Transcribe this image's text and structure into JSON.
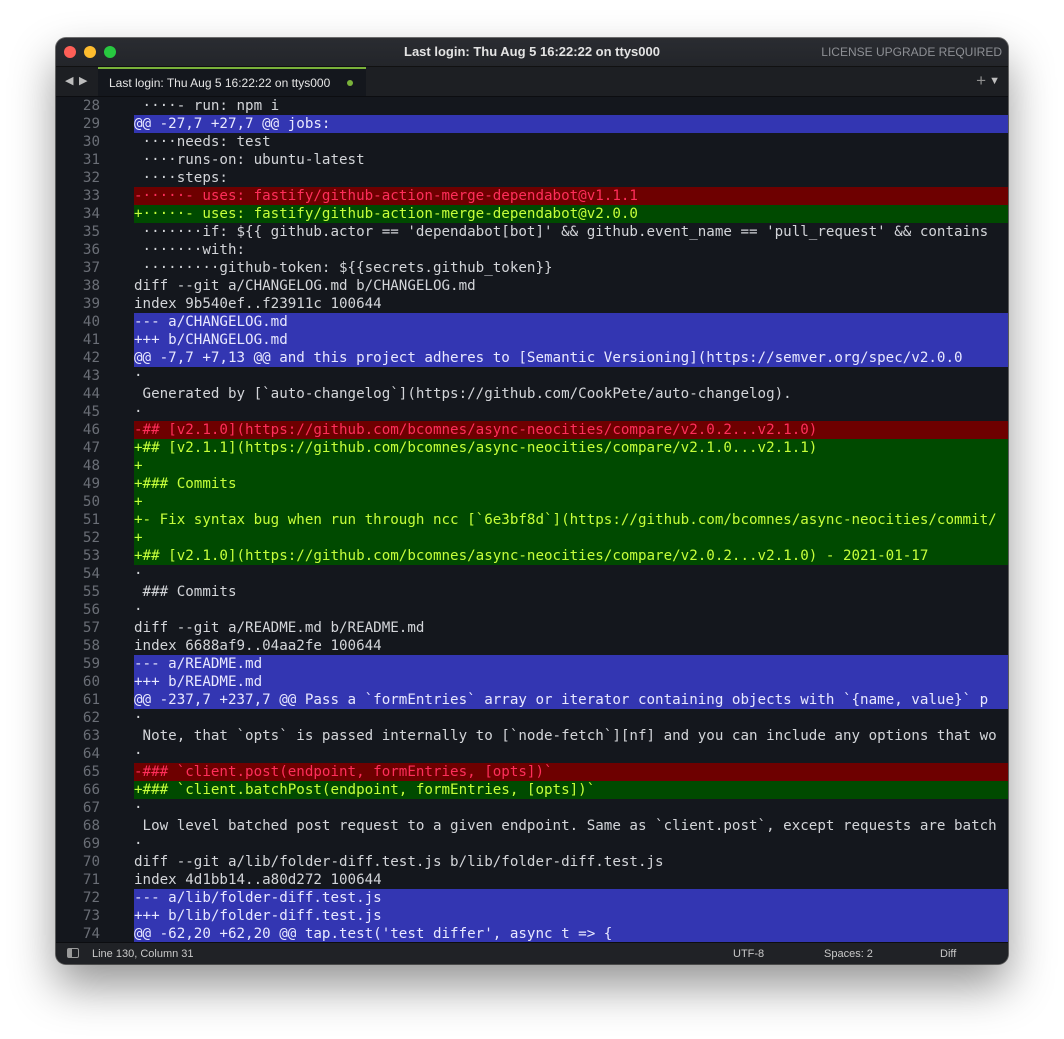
{
  "window": {
    "title": "Last login: Thu Aug  5 16:22:22 on ttys000",
    "license_notice": "LICENSE UPGRADE REQUIRED"
  },
  "tabs": [
    {
      "label": "Last login: Thu Aug  5 16:22:22 on ttys000",
      "modified": true
    }
  ],
  "tabbar": {
    "back_icon": "◀",
    "forward_icon": "▶",
    "new_tab_icon": "+",
    "tab_menu_icon": "▼"
  },
  "colors": {
    "hunk_bg": "#3336b2",
    "removed_bg": "#6e0000",
    "removed_fg": "#ff2e5a",
    "added_bg": "#004a00",
    "added_fg": "#c5ff3a",
    "editor_bg": "#14171d",
    "tab_accent": "#7ab23a"
  },
  "lines": [
    {
      "n": "28",
      "type": "context",
      "text": " ····- run: npm i"
    },
    {
      "n": "29",
      "type": "hunk",
      "text": "@@ -27,7 +27,7 @@ jobs:"
    },
    {
      "n": "30",
      "type": "context",
      "text": " ····needs: test"
    },
    {
      "n": "31",
      "type": "context",
      "text": " ····runs-on: ubuntu-latest"
    },
    {
      "n": "32",
      "type": "context",
      "text": " ····steps:"
    },
    {
      "n": "33",
      "type": "removed",
      "text": "-·····- uses: fastify/github-action-merge-dependabot@v1.1.1"
    },
    {
      "n": "34",
      "type": "added",
      "text": "+·····- uses: fastify/github-action-merge-dependabot@v2.0.0"
    },
    {
      "n": "35",
      "type": "context",
      "text": " ·······if: ${{ github.actor == 'dependabot[bot]' && github.event_name == 'pull_request' && contains"
    },
    {
      "n": "36",
      "type": "context",
      "text": " ·······with:"
    },
    {
      "n": "37",
      "type": "context",
      "text": " ·········github-token: ${{secrets.github_token}}"
    },
    {
      "n": "38",
      "type": "context",
      "text": "diff --git a/CHANGELOG.md b/CHANGELOG.md"
    },
    {
      "n": "39",
      "type": "context",
      "text": "index 9b540ef..f23911c 100644"
    },
    {
      "n": "40",
      "type": "header",
      "text": "--- a/CHANGELOG.md"
    },
    {
      "n": "41",
      "type": "header",
      "text": "+++ b/CHANGELOG.md"
    },
    {
      "n": "42",
      "type": "hunk",
      "text": "@@ -7,7 +7,13 @@ and this project adheres to [Semantic Versioning](https://semver.org/spec/v2.0.0"
    },
    {
      "n": "43",
      "type": "context",
      "text": "·"
    },
    {
      "n": "44",
      "type": "context",
      "text": " Generated by [`auto-changelog`](https://github.com/CookPete/auto-changelog)."
    },
    {
      "n": "45",
      "type": "context",
      "text": "·"
    },
    {
      "n": "46",
      "type": "removed",
      "text": "-## [v2.1.0](https://github.com/bcomnes/async-neocities/compare/v2.0.2...v2.1.0)"
    },
    {
      "n": "47",
      "type": "added",
      "text": "+## [v2.1.1](https://github.com/bcomnes/async-neocities/compare/v2.1.0...v2.1.1)"
    },
    {
      "n": "48",
      "type": "added",
      "text": "+"
    },
    {
      "n": "49",
      "type": "added",
      "text": "+### Commits"
    },
    {
      "n": "50",
      "type": "added",
      "text": "+"
    },
    {
      "n": "51",
      "type": "added",
      "text": "+- Fix syntax bug when run through ncc [`6e3bf8d`](https://github.com/bcomnes/async-neocities/commit/"
    },
    {
      "n": "52",
      "type": "added",
      "text": "+"
    },
    {
      "n": "53",
      "type": "added",
      "text": "+## [v2.1.0](https://github.com/bcomnes/async-neocities/compare/v2.0.2...v2.1.0) - 2021-01-17"
    },
    {
      "n": "54",
      "type": "context",
      "text": "·"
    },
    {
      "n": "55",
      "type": "context",
      "text": " ### Commits"
    },
    {
      "n": "56",
      "type": "context",
      "text": "·"
    },
    {
      "n": "57",
      "type": "context",
      "text": "diff --git a/README.md b/README.md"
    },
    {
      "n": "58",
      "type": "context",
      "text": "index 6688af9..04aa2fe 100644"
    },
    {
      "n": "59",
      "type": "header",
      "text": "--- a/README.md"
    },
    {
      "n": "60",
      "type": "header",
      "text": "+++ b/README.md"
    },
    {
      "n": "61",
      "type": "hunk",
      "text": "@@ -237,7 +237,7 @@ Pass a `formEntries` array or iterator containing objects with `{name, value}` p"
    },
    {
      "n": "62",
      "type": "context",
      "text": "·"
    },
    {
      "n": "63",
      "type": "context",
      "text": " Note, that `opts` is passed internally to [`node-fetch`][nf] and you can include any options that wo"
    },
    {
      "n": "64",
      "type": "context",
      "text": "·"
    },
    {
      "n": "65",
      "type": "removed",
      "text": "-### `client.post(endpoint, formEntries, [opts])`"
    },
    {
      "n": "66",
      "type": "added",
      "text": "+### `client.batchPost(endpoint, formEntries, [opts])`"
    },
    {
      "n": "67",
      "type": "context",
      "text": "·"
    },
    {
      "n": "68",
      "type": "context",
      "text": " Low level batched post request to a given endpoint. Same as `client.post`, except requests are batch"
    },
    {
      "n": "69",
      "type": "context",
      "text": "·"
    },
    {
      "n": "70",
      "type": "context",
      "text": "diff --git a/lib/folder-diff.test.js b/lib/folder-diff.test.js"
    },
    {
      "n": "71",
      "type": "context",
      "text": "index 4d1bb14..a80d272 100644"
    },
    {
      "n": "72",
      "type": "header",
      "text": "--- a/lib/folder-diff.test.js"
    },
    {
      "n": "73",
      "type": "header",
      "text": "+++ b/lib/folder-diff.test.js"
    },
    {
      "n": "74",
      "type": "hunk",
      "text": "@@ -62,20 +62,20 @@ tap.test('test differ', async t => {"
    }
  ],
  "statusbar": {
    "position": "Line 130, Column 31",
    "encoding": "UTF-8",
    "indentation": "Spaces: 2",
    "syntax": "Diff"
  }
}
